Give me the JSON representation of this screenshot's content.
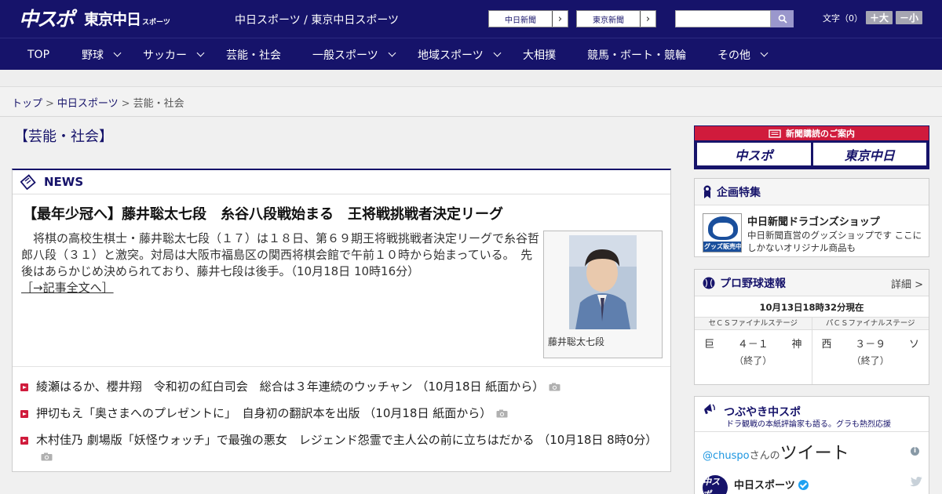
{
  "header": {
    "logo_chuspo": "中スポ",
    "logo_tokyo": "東京中日",
    "logo_tokyo_small": "スポーツ",
    "site_name": "中日スポーツ / 東京中日スポーツ",
    "link_chunichi": "中日新聞",
    "link_tokyo": "東京新聞",
    "search_placeholder": "",
    "fontsize_label": "文字（0）",
    "fontsize_plus": "＋大",
    "fontsize_minus": "－小"
  },
  "nav": {
    "items": [
      {
        "label": "TOP"
      },
      {
        "label": "野球"
      },
      {
        "label": "サッカー"
      },
      {
        "label": "芸能・社会"
      },
      {
        "label": "一般スポーツ"
      },
      {
        "label": "地域スポーツ"
      },
      {
        "label": "大相撲"
      },
      {
        "label": "競馬・ボート・競輪"
      },
      {
        "label": "その他"
      }
    ]
  },
  "breadcrumb": {
    "top": "トップ",
    "section": "中日スポーツ",
    "current": "芸能・社会",
    "sep": ">"
  },
  "page_title": "【芸能・社会】",
  "news": {
    "header": "NEWS",
    "headline": "【最年少冠へ】藤井聡太七段　糸谷八段戦始まる　王将戦挑戦者決定リーグ",
    "lead": "　将棋の高校生棋士・藤井聡太七段（１７）は１８日、第６９期王将戦挑戦者決定リーグで糸谷哲郎八段（３１）と激突。対局は大阪市福島区の関西将棋会館で午前１０時から始まっている。　先後はあらかじめ決められており、藤井七段は後手。（10月18日 10時16分）",
    "more": "［→記事全文へ］",
    "photo_caption": "藤井聡太七段",
    "list": [
      {
        "text": "綾瀬はるか、櫻井翔　令和初の紅白司会　総合は３年連続のウッチャン （10月18日 紙面から）"
      },
      {
        "text": "押切もえ「奥さまへのプレゼントに」　自身初の翻訳本を出版 （10月18日 紙面から）"
      },
      {
        "text": "木村佳乃 劇場版「妖怪ウォッチ」で最強の悪女　レジェンド怨霊で主人公の前に立ちはだかる （10月18日 8時0分）"
      }
    ]
  },
  "subscription": {
    "title": "新聞購読のご案内",
    "logo1": "中スポ",
    "logo2": "東京中日"
  },
  "feature": {
    "title": "企画特集",
    "item_title": "中日新聞ドラゴンズショップ",
    "item_desc": "中日新聞直営のグッズショップです ここにしかないオリジナル商品も",
    "thumb_label": "グッズ販売中"
  },
  "baseball": {
    "title": "プロ野球速報",
    "detail": "詳細 >",
    "timestamp": "10月13日18時32分現在",
    "games": [
      {
        "stage": "セＣＳファイナルステージ",
        "home": "巨",
        "score": "４－１",
        "away": "神",
        "status": "（終了）"
      },
      {
        "stage": "パＣＳファイナルステージ",
        "home": "西",
        "score": "３－９",
        "away": "ソ",
        "status": "（終了）"
      }
    ]
  },
  "tweet": {
    "title": "つぶやき中スポ",
    "subtitle": "ドラ観戦の本紙評論家も語る。グラも熱烈応援",
    "handle": "@chuspo",
    "handle_suffix": "さんの",
    "big": "ツイート",
    "account_name": "中日スポーツ",
    "avatar_text": "中スポ"
  },
  "colors": {
    "brand_navy": "#16136a",
    "accent_red": "#d01b3c"
  }
}
